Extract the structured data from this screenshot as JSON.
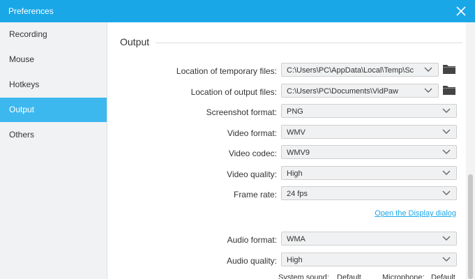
{
  "window": {
    "title": "Preferences"
  },
  "sidebar": {
    "items": [
      {
        "label": "Recording"
      },
      {
        "label": "Mouse"
      },
      {
        "label": "Hotkeys"
      },
      {
        "label": "Output"
      },
      {
        "label": "Others"
      }
    ]
  },
  "output": {
    "heading": "Output",
    "temp_files": {
      "label": "Location of temporary files:",
      "value": "C:\\Users\\PC\\AppData\\Local\\Temp\\Sc"
    },
    "output_files": {
      "label": "Location of output files:",
      "value": "C:\\Users\\PC\\Documents\\VidPaw"
    },
    "screenshot_format": {
      "label": "Screenshot format:",
      "value": "PNG"
    },
    "video_format": {
      "label": "Video format:",
      "value": "WMV"
    },
    "video_codec": {
      "label": "Video codec:",
      "value": "WMV9"
    },
    "video_quality": {
      "label": "Video quality:",
      "value": "High"
    },
    "frame_rate": {
      "label": "Frame rate:",
      "value": "24 fps"
    },
    "display_link": "Open the Display dialog",
    "audio_format": {
      "label": "Audio format:",
      "value": "WMA"
    },
    "audio_quality": {
      "label": "Audio quality:",
      "value": "High"
    },
    "system_sound": {
      "label": "System sound:",
      "value": "Default"
    },
    "microphone": {
      "label": "Microphone:",
      "value": "Default"
    }
  }
}
